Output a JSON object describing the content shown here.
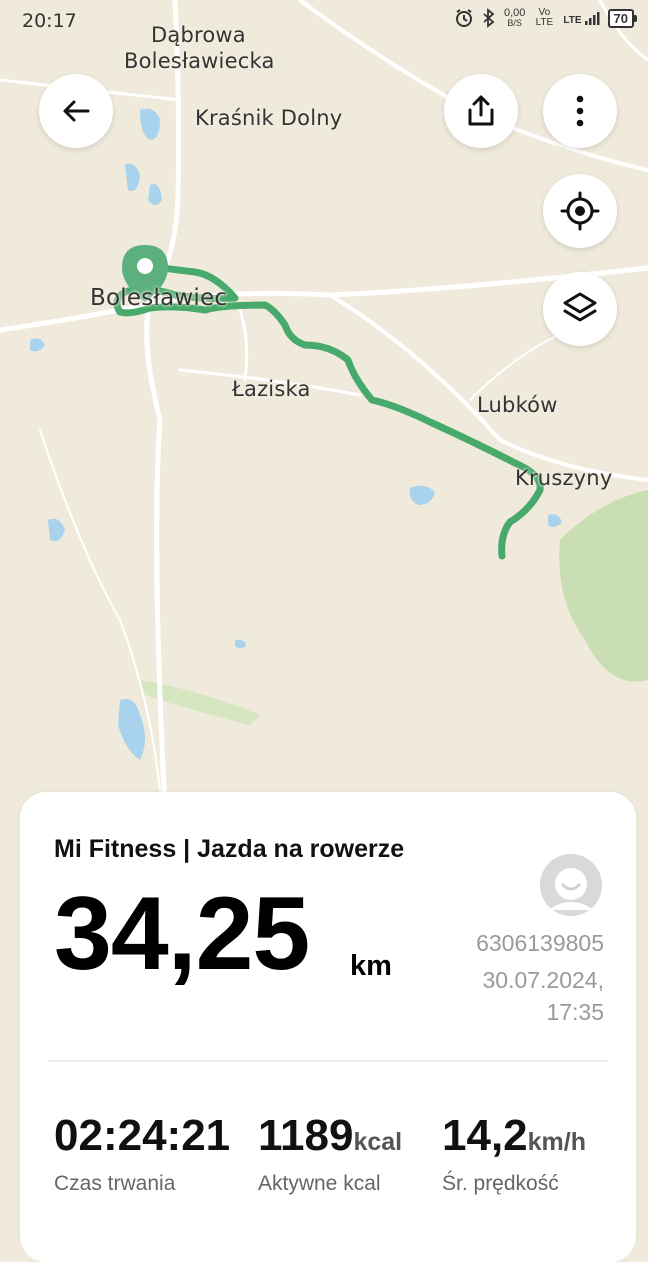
{
  "status_bar": {
    "time": "20:17",
    "net_speed": "0,00",
    "net_unit": "B/S",
    "volte": "Vo LTE",
    "lte": "LTE",
    "battery": "70"
  },
  "map": {
    "labels": {
      "dabrowa_line1": "Dąbrowa",
      "dabrowa_line2": "Bolesławiecka",
      "krasnik": "Kraśnik Dolny",
      "boleslawiec": "Bolesławiec",
      "laziska": "Łaziska",
      "lubkow": "Lubków",
      "kruszyny": "Kruszyny"
    },
    "colors": {
      "route": "#47a96b",
      "pin": "#5bb07e",
      "water": "#a9d3ec",
      "road": "#ffffff",
      "forest": "#c9dfb3"
    }
  },
  "toolbar": {
    "back_icon": "arrow-left-icon",
    "share_icon": "share-icon",
    "more_icon": "more-vertical-icon",
    "locate_icon": "crosshair-icon",
    "layers_icon": "layers-icon"
  },
  "summary": {
    "title": "Mi Fitness | Jazda na rowerze",
    "distance": "34,25",
    "distance_unit": "km",
    "user_id": "6306139805",
    "date": "30.07.2024,",
    "time": "17:35",
    "stats": [
      {
        "value": "02:24:21",
        "unit": "",
        "label": "Czas trwania"
      },
      {
        "value": "1189",
        "unit": "kcal",
        "label": "Aktywne kcal"
      },
      {
        "value": "14,2",
        "unit": "km/h",
        "label": "Śr. prędkość"
      }
    ]
  }
}
